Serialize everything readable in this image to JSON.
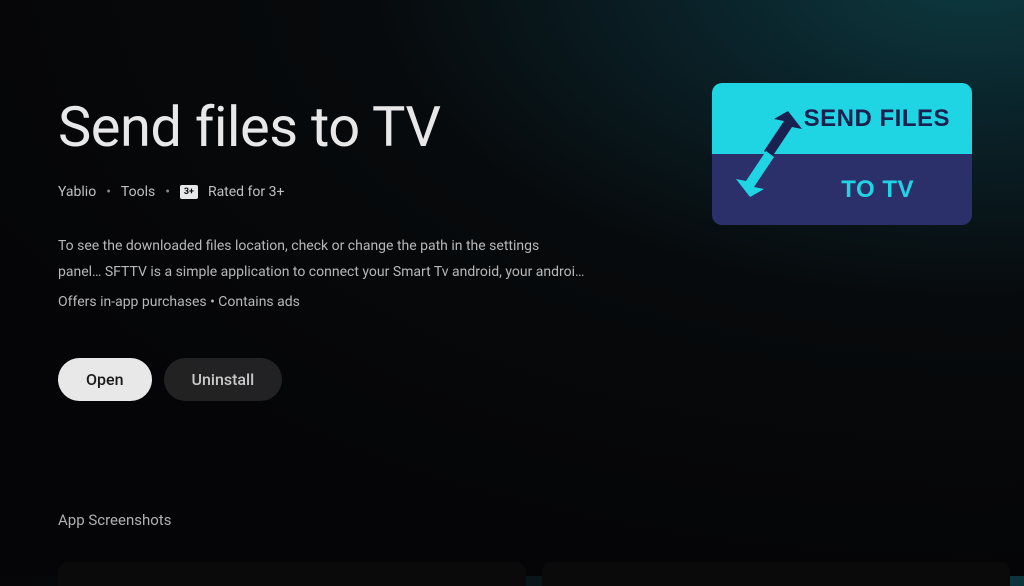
{
  "app": {
    "title": "Send files to TV",
    "developer": "Yablio",
    "category": "Tools",
    "rating_badge": "3+",
    "rating_label": "Rated for 3+",
    "description_line1": "To see the downloaded files location, check or change the path in the settings",
    "description_line2": "panel… SFTTV is a simple application to connect your Smart Tv android, your androi…",
    "purchases_note": "Offers in-app purchases  •  Contains ads",
    "icon_text_top": "SEND FILES",
    "icon_text_bottom": "TO TV"
  },
  "buttons": {
    "open_label": "Open",
    "uninstall_label": "Uninstall"
  },
  "sections": {
    "screenshots_label": "App Screenshots"
  },
  "colors": {
    "icon_top_bg": "#20d5e3",
    "icon_bottom_bg": "#2b2f6a"
  }
}
